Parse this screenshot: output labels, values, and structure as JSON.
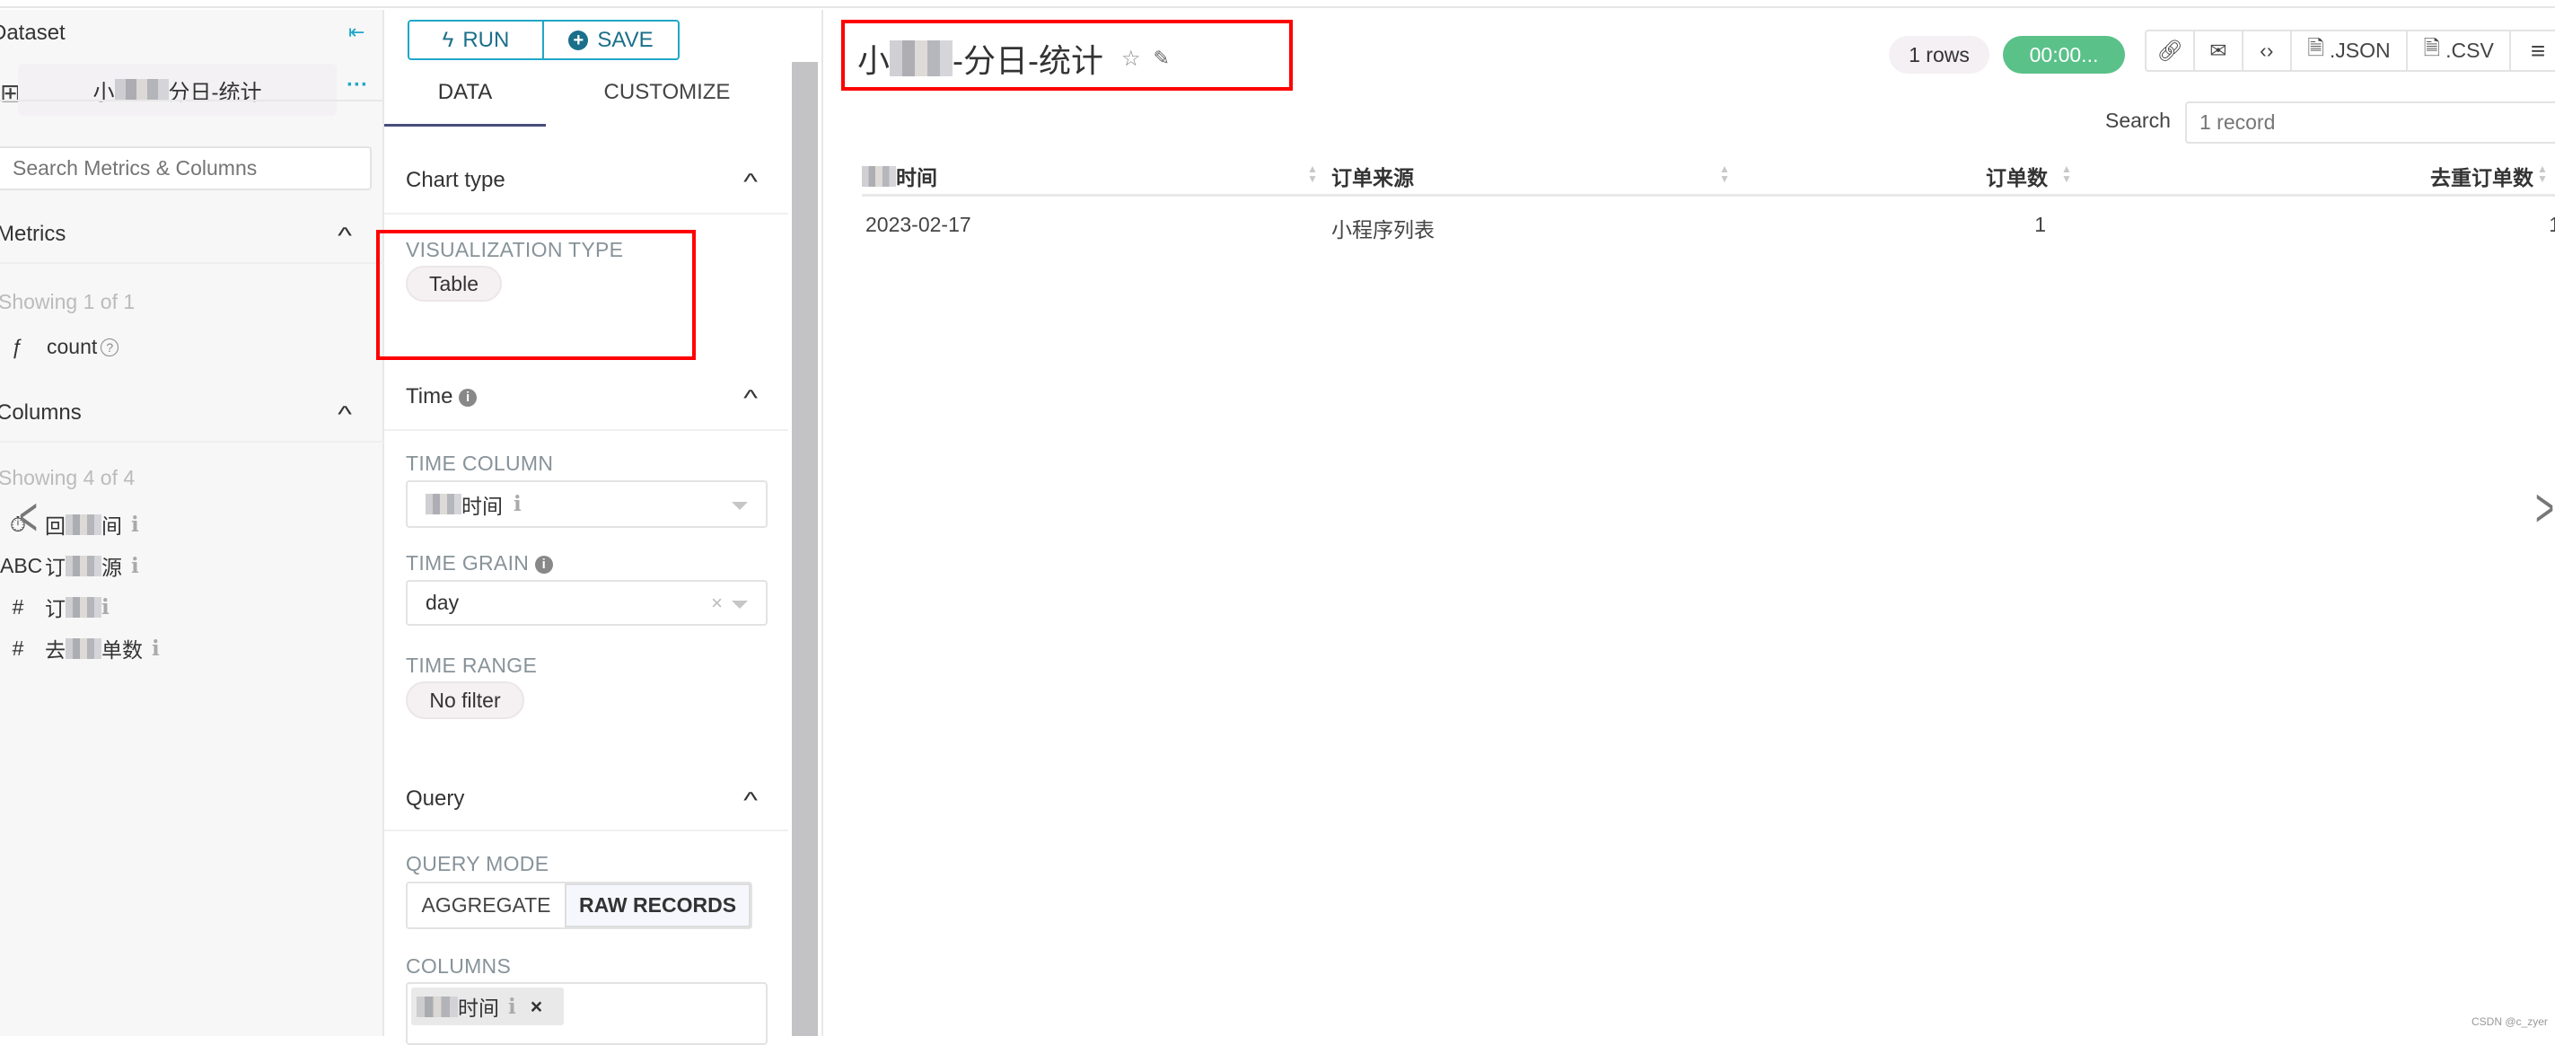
{
  "left": {
    "dataset_label": "Dataset",
    "dataset_name_prefix": "小",
    "dataset_name_suffix": "分日-统计",
    "more": "···",
    "search_placeholder": "Search Metrics & Columns",
    "metrics": {
      "title": "Metrics",
      "showing": "Showing 1 of 1",
      "items": [
        {
          "type": "ƒ",
          "name": "count"
        }
      ]
    },
    "columns": {
      "title": "Columns",
      "showing": "Showing 4 of 4",
      "items": [
        {
          "type": "⏱",
          "pre": "回",
          "post": "间"
        },
        {
          "type": "ABC",
          "pre": "订",
          "post": "源"
        },
        {
          "type": "#",
          "pre": "订",
          "post": ""
        },
        {
          "type": "#",
          "pre": "去",
          "post": "单数"
        }
      ]
    }
  },
  "mid": {
    "run": "RUN",
    "save": "SAVE",
    "tabs": [
      "DATA",
      "CUSTOMIZE"
    ],
    "chart_type": {
      "title": "Chart type",
      "viz_label": "VISUALIZATION TYPE",
      "viz_value": "Table"
    },
    "time": {
      "title": "Time",
      "time_column_label": "TIME COLUMN",
      "time_column_value": "时间",
      "time_grain_label": "TIME GRAIN",
      "time_grain_value": "day",
      "time_range_label": "TIME RANGE",
      "time_range_value": "No filter"
    },
    "query": {
      "title": "Query",
      "mode_label": "QUERY MODE",
      "modes": [
        "AGGREGATE",
        "RAW RECORDS"
      ],
      "active_mode": "RAW RECORDS",
      "columns_label": "COLUMNS",
      "column_chip": "时间"
    }
  },
  "right": {
    "title_prefix": "小",
    "title_suffix": "-分日-统计",
    "rows_badge": "1 rows",
    "time_badge": "00:00...",
    "json": ".JSON",
    "csv": ".CSV",
    "search_label": "Search",
    "search_placeholder": "1 record",
    "table": {
      "headers": [
        "时间",
        "订单来源",
        "订单数",
        "去重订单数"
      ],
      "rows": [
        [
          "2023-02-17",
          "小程序列表",
          "1",
          "1"
        ]
      ]
    },
    "watermark": "CSDN @c_zyer"
  },
  "colors": {
    "accent": "#20a7c9",
    "success": "#5ac189",
    "highlight": "#ff0000",
    "tab_underline": "#484c7a"
  }
}
